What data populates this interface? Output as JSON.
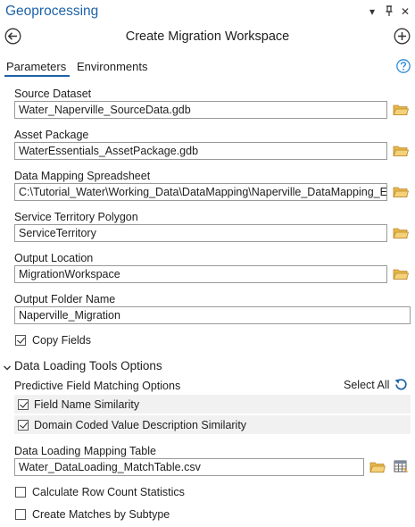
{
  "pane": {
    "title": "Geoprocessing",
    "dropdown_glyph": "▾",
    "pin_glyph": "ᵖ",
    "close_glyph": "✕"
  },
  "header": {
    "title": "Create Migration Workspace"
  },
  "tabs": [
    {
      "label": "Parameters",
      "active": true
    },
    {
      "label": "Environments",
      "active": false
    }
  ],
  "params": {
    "source_dataset": {
      "label": "Source Dataset",
      "value": "Water_Naperville_SourceData.gdb"
    },
    "asset_package": {
      "label": "Asset Package",
      "value": "WaterEssentials_AssetPackage.gdb"
    },
    "data_mapping": {
      "label": "Data Mapping Spreadsheet",
      "value": "C:\\Tutorial_Water\\Working_Data\\DataMapping\\Naperville_DataMapping_Exte"
    },
    "service_territory": {
      "label": "Service Territory Polygon",
      "value": "ServiceTerritory"
    },
    "output_location": {
      "label": "Output Location",
      "value": "MigrationWorkspace"
    },
    "output_folder": {
      "label": "Output Folder Name",
      "value": "Naperville_Migration"
    },
    "copy_fields": {
      "label": "Copy Fields",
      "checked": true
    }
  },
  "data_loading": {
    "section_title": "Data Loading Tools Options",
    "predictive_label": "Predictive Field Matching Options",
    "select_all": "Select All",
    "options": [
      {
        "label": "Field Name Similarity",
        "checked": true
      },
      {
        "label": "Domain Coded Value Description Similarity",
        "checked": true
      }
    ],
    "mapping_table": {
      "label": "Data Loading Mapping Table",
      "value": "Water_DataLoading_MatchTable.csv"
    },
    "row_count": {
      "label": "Calculate Row Count Statistics",
      "checked": false
    },
    "by_subtype": {
      "label": "Create Matches by Subtype",
      "checked": false
    }
  },
  "colors": {
    "accent": "#1d62a8",
    "folder": "#e8b84a",
    "help": "#2a8ad4"
  }
}
